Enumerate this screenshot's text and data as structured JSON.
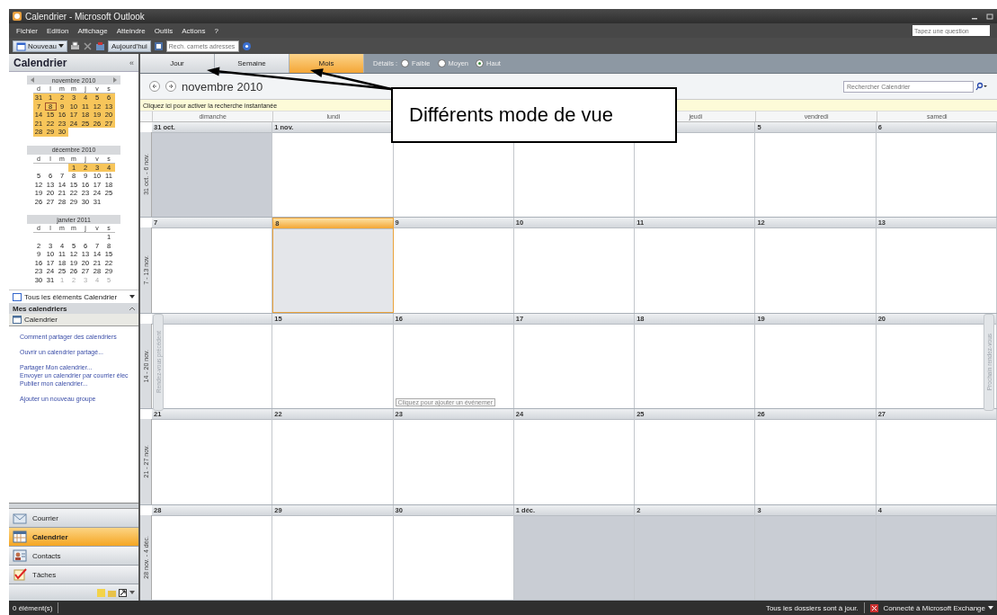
{
  "window": {
    "title": "Calendrier - Microsoft Outlook"
  },
  "menu": [
    "Fichier",
    "Edition",
    "Affichage",
    "Atteindre",
    "Outils",
    "Actions",
    "?"
  ],
  "help_box": {
    "placeholder": "Tapez une question"
  },
  "toolbar": {
    "new_label": "Nouveau",
    "today_label": "Aujourd'hui",
    "address_search": {
      "placeholder": "Rech. carnets adresses"
    }
  },
  "sidebar": {
    "title": "Calendrier",
    "collapse": "«",
    "mini_months": [
      {
        "title": "novembre 2010",
        "nav": true,
        "weekdays": [
          "d",
          "l",
          "m",
          "m",
          "j",
          "v",
          "s"
        ],
        "weeks": [
          {
            "days": [
              {
                "d": "31",
                "hl": true,
                "today": false,
                "dim": false
              },
              {
                "d": "1",
                "hl": true,
                "today": false,
                "dim": false
              },
              {
                "d": "2",
                "hl": true,
                "today": false,
                "dim": false
              },
              {
                "d": "3",
                "hl": true,
                "today": false,
                "dim": false
              },
              {
                "d": "4",
                "hl": true,
                "today": false,
                "dim": false
              },
              {
                "d": "5",
                "hl": true,
                "today": false,
                "dim": false
              },
              {
                "d": "6",
                "hl": true,
                "today": false,
                "dim": false
              }
            ]
          },
          {
            "days": [
              {
                "d": "7",
                "hl": true,
                "today": false,
                "dim": false
              },
              {
                "d": "8",
                "hl": true,
                "today": true,
                "dim": false
              },
              {
                "d": "9",
                "hl": true,
                "today": false,
                "dim": false
              },
              {
                "d": "10",
                "hl": true,
                "today": false,
                "dim": false
              },
              {
                "d": "11",
                "hl": true,
                "today": false,
                "dim": false
              },
              {
                "d": "12",
                "hl": true,
                "today": false,
                "dim": false
              },
              {
                "d": "13",
                "hl": true,
                "today": false,
                "dim": false
              }
            ]
          },
          {
            "days": [
              {
                "d": "14",
                "hl": true,
                "today": false,
                "dim": false
              },
              {
                "d": "15",
                "hl": true,
                "today": false,
                "dim": false
              },
              {
                "d": "16",
                "hl": true,
                "today": false,
                "dim": false
              },
              {
                "d": "17",
                "hl": true,
                "today": false,
                "dim": false
              },
              {
                "d": "18",
                "hl": true,
                "today": false,
                "dim": false
              },
              {
                "d": "19",
                "hl": true,
                "today": false,
                "dim": false
              },
              {
                "d": "20",
                "hl": true,
                "today": false,
                "dim": false
              }
            ]
          },
          {
            "days": [
              {
                "d": "21",
                "hl": true,
                "today": false,
                "dim": false
              },
              {
                "d": "22",
                "hl": true,
                "today": false,
                "dim": false
              },
              {
                "d": "23",
                "hl": true,
                "today": false,
                "dim": false
              },
              {
                "d": "24",
                "hl": true,
                "today": false,
                "dim": false
              },
              {
                "d": "25",
                "hl": true,
                "today": false,
                "dim": false
              },
              {
                "d": "26",
                "hl": true,
                "today": false,
                "dim": false
              },
              {
                "d": "27",
                "hl": true,
                "today": false,
                "dim": false
              }
            ]
          },
          {
            "days": [
              {
                "d": "28",
                "hl": true,
                "today": false,
                "dim": false
              },
              {
                "d": "29",
                "hl": true,
                "today": false,
                "dim": false
              },
              {
                "d": "30",
                "hl": true,
                "today": false,
                "dim": false
              }
            ]
          }
        ]
      },
      {
        "title": "décembre 2010",
        "nav": false,
        "weekdays": [
          "d",
          "l",
          "m",
          "m",
          "j",
          "v",
          "s"
        ],
        "weeks": [
          {
            "days": [
              {
                "d": "1",
                "hl": true,
                "today": false,
                "dim": false
              },
              {
                "d": "2",
                "hl": true,
                "today": false,
                "dim": false
              },
              {
                "d": "3",
                "hl": true,
                "today": false,
                "dim": false
              },
              {
                "d": "4",
                "hl": true,
                "today": false,
                "dim": false
              }
            ]
          },
          {
            "days": [
              {
                "d": "5",
                "hl": false,
                "today": false,
                "dim": false
              },
              {
                "d": "6",
                "hl": false,
                "today": false,
                "dim": false
              },
              {
                "d": "7",
                "hl": false,
                "today": false,
                "dim": false
              },
              {
                "d": "8",
                "hl": false,
                "today": false,
                "dim": false
              },
              {
                "d": "9",
                "hl": false,
                "today": false,
                "dim": false
              },
              {
                "d": "10",
                "hl": false,
                "today": false,
                "dim": false
              },
              {
                "d": "11",
                "hl": false,
                "today": false,
                "dim": false
              }
            ]
          },
          {
            "days": [
              {
                "d": "12",
                "hl": false,
                "today": false,
                "dim": false
              },
              {
                "d": "13",
                "hl": false,
                "today": false,
                "dim": false
              },
              {
                "d": "14",
                "hl": false,
                "today": false,
                "dim": false
              },
              {
                "d": "15",
                "hl": false,
                "today": false,
                "dim": false
              },
              {
                "d": "16",
                "hl": false,
                "today": false,
                "dim": false
              },
              {
                "d": "17",
                "hl": false,
                "today": false,
                "dim": false
              },
              {
                "d": "18",
                "hl": false,
                "today": false,
                "dim": false
              }
            ]
          },
          {
            "days": [
              {
                "d": "19",
                "hl": false,
                "today": false,
                "dim": false
              },
              {
                "d": "20",
                "hl": false,
                "today": false,
                "dim": false
              },
              {
                "d": "21",
                "hl": false,
                "today": false,
                "dim": false
              },
              {
                "d": "22",
                "hl": false,
                "today": false,
                "dim": false
              },
              {
                "d": "23",
                "hl": false,
                "today": false,
                "dim": false
              },
              {
                "d": "24",
                "hl": false,
                "today": false,
                "dim": false
              },
              {
                "d": "25",
                "hl": false,
                "today": false,
                "dim": false
              }
            ]
          },
          {
            "days": [
              {
                "d": "26",
                "hl": false,
                "today": false,
                "dim": false
              },
              {
                "d": "27",
                "hl": false,
                "today": false,
                "dim": false
              },
              {
                "d": "28",
                "hl": false,
                "today": false,
                "dim": false
              },
              {
                "d": "29",
                "hl": false,
                "today": false,
                "dim": false
              },
              {
                "d": "30",
                "hl": false,
                "today": false,
                "dim": false
              },
              {
                "d": "31",
                "hl": false,
                "today": false,
                "dim": false
              }
            ]
          }
        ]
      },
      {
        "title": "janvier 2011",
        "nav": false,
        "weekdays": [
          "d",
          "l",
          "m",
          "m",
          "j",
          "v",
          "s"
        ],
        "weeks": [
          {
            "days": [
              {
                "d": "1",
                "hl": false,
                "today": false,
                "dim": false
              }
            ]
          },
          {
            "days": [
              {
                "d": "2",
                "hl": false,
                "today": false,
                "dim": false
              },
              {
                "d": "3",
                "hl": false,
                "today": false,
                "dim": false
              },
              {
                "d": "4",
                "hl": false,
                "today": false,
                "dim": false
              },
              {
                "d": "5",
                "hl": false,
                "today": false,
                "dim": false
              },
              {
                "d": "6",
                "hl": false,
                "today": false,
                "dim": false
              },
              {
                "d": "7",
                "hl": false,
                "today": false,
                "dim": false
              },
              {
                "d": "8",
                "hl": false,
                "today": false,
                "dim": false
              }
            ]
          },
          {
            "days": [
              {
                "d": "9",
                "hl": false,
                "today": false,
                "dim": false
              },
              {
                "d": "10",
                "hl": false,
                "today": false,
                "dim": false
              },
              {
                "d": "11",
                "hl": false,
                "today": false,
                "dim": false
              },
              {
                "d": "12",
                "hl": false,
                "today": false,
                "dim": false
              },
              {
                "d": "13",
                "hl": false,
                "today": false,
                "dim": false
              },
              {
                "d": "14",
                "hl": false,
                "today": false,
                "dim": false
              },
              {
                "d": "15",
                "hl": false,
                "today": false,
                "dim": false
              }
            ]
          },
          {
            "days": [
              {
                "d": "16",
                "hl": false,
                "today": false,
                "dim": false
              },
              {
                "d": "17",
                "hl": false,
                "today": false,
                "dim": false
              },
              {
                "d": "18",
                "hl": false,
                "today": false,
                "dim": false
              },
              {
                "d": "19",
                "hl": false,
                "today": false,
                "dim": false
              },
              {
                "d": "20",
                "hl": false,
                "today": false,
                "dim": false
              },
              {
                "d": "21",
                "hl": false,
                "today": false,
                "dim": false
              },
              {
                "d": "22",
                "hl": false,
                "today": false,
                "dim": false
              }
            ]
          },
          {
            "days": [
              {
                "d": "23",
                "hl": false,
                "today": false,
                "dim": false
              },
              {
                "d": "24",
                "hl": false,
                "today": false,
                "dim": false
              },
              {
                "d": "25",
                "hl": false,
                "today": false,
                "dim": false
              },
              {
                "d": "26",
                "hl": false,
                "today": false,
                "dim": false
              },
              {
                "d": "27",
                "hl": false,
                "today": false,
                "dim": false
              },
              {
                "d": "28",
                "hl": false,
                "today": false,
                "dim": false
              },
              {
                "d": "29",
                "hl": false,
                "today": false,
                "dim": false
              }
            ]
          },
          {
            "days": [
              {
                "d": "30",
                "hl": false,
                "today": false,
                "dim": false
              },
              {
                "d": "31",
                "hl": false,
                "today": false,
                "dim": false
              },
              {
                "d": "1",
                "hl": false,
                "today": false,
                "dim": true
              },
              {
                "d": "2",
                "hl": false,
                "today": false,
                "dim": true
              },
              {
                "d": "3",
                "hl": false,
                "today": false,
                "dim": true
              },
              {
                "d": "4",
                "hl": false,
                "today": false,
                "dim": true
              },
              {
                "d": "5",
                "hl": false,
                "today": false,
                "dim": true
              }
            ]
          }
        ]
      }
    ],
    "all_items": "Tous les éléments Calendrier",
    "my_calendars": {
      "title": "Mes calendriers",
      "items": [
        "Calendrier"
      ]
    },
    "link_groups": [
      [
        "Comment partager des calendriers"
      ],
      [
        "Ouvrir un calendrier partagé..."
      ],
      [
        "Partager Mon calendrier...",
        "Envoyer un calendrier par courrier élec",
        "Publier mon calendrier..."
      ],
      [
        "Ajouter un nouveau groupe"
      ]
    ],
    "nav": [
      {
        "label": "Courrier",
        "kind": "mail",
        "selected": false
      },
      {
        "label": "Calendrier",
        "kind": "calendar",
        "selected": true
      },
      {
        "label": "Contacts",
        "kind": "contacts",
        "selected": false
      },
      {
        "label": "Tâches",
        "kind": "tasks",
        "selected": false
      }
    ]
  },
  "view_tabs": [
    {
      "label": "Jour",
      "selected": false
    },
    {
      "label": "Semaine",
      "selected": false
    },
    {
      "label": "Mois",
      "selected": true
    }
  ],
  "details": {
    "label": "Détails :",
    "options": [
      {
        "label": "Faible",
        "selected": false
      },
      {
        "label": "Moyen",
        "selected": false
      },
      {
        "label": "Haut",
        "selected": true
      }
    ]
  },
  "month_title": "novembre 2010",
  "search": {
    "placeholder": "Rechercher Calendrier"
  },
  "instant_search_bar": "Cliquez ici pour activer la recherche instantanée",
  "weekdays_left": [
    "dimanche",
    "lundi"
  ],
  "weekdays_right": [
    "jeudi",
    "vendredi",
    "samedi"
  ],
  "weeks": [
    {
      "label": "31 oct. - 6 nov.",
      "days": [
        {
          "date": "31 oct.",
          "other": true,
          "today": false,
          "selected": false
        },
        {
          "date": "1 nov.",
          "other": false,
          "today": false,
          "selected": false
        },
        {
          "other": false,
          "selected": false
        },
        {
          "other": false,
          "selected": false
        },
        {
          "other": false,
          "selected": false
        },
        {
          "date": "5",
          "other": false,
          "today": false,
          "selected": false
        },
        {
          "date": "6",
          "other": false,
          "today": false,
          "selected": false
        }
      ]
    },
    {
      "label": "7 - 13 nov.",
      "days": [
        {
          "date": "7",
          "other": false,
          "today": false,
          "selected": false
        },
        {
          "date": "8",
          "other": false,
          "today": true,
          "selected": true
        },
        {
          "date": "9",
          "other": false,
          "today": false,
          "selected": false
        },
        {
          "date": "10",
          "other": false,
          "today": false,
          "selected": false
        },
        {
          "date": "11",
          "other": false,
          "today": false,
          "selected": false
        },
        {
          "date": "12",
          "other": false,
          "today": false,
          "selected": false
        },
        {
          "date": "13",
          "other": false,
          "today": false,
          "selected": false
        }
      ]
    },
    {
      "label": "14 - 20 nov.",
      "days": [
        {
          "other": false,
          "selected": false
        },
        {
          "date": "15",
          "other": false,
          "today": false,
          "selected": false
        },
        {
          "date": "16",
          "other": false,
          "today": false,
          "selected": false,
          "hint": "Cliquez pour ajouter un événemer"
        },
        {
          "date": "17",
          "other": false,
          "today": false,
          "selected": false
        },
        {
          "date": "18",
          "other": false,
          "today": false,
          "selected": false
        },
        {
          "date": "19",
          "other": false,
          "today": false,
          "selected": false
        },
        {
          "date": "20",
          "other": false,
          "today": false,
          "selected": false
        }
      ]
    },
    {
      "label": "21 - 27 nov.",
      "days": [
        {
          "date": "21",
          "other": false,
          "today": false,
          "selected": false
        },
        {
          "date": "22",
          "other": false,
          "today": false,
          "selected": false
        },
        {
          "date": "23",
          "other": false,
          "today": false,
          "selected": false
        },
        {
          "date": "24",
          "other": false,
          "today": false,
          "selected": false
        },
        {
          "date": "25",
          "other": false,
          "today": false,
          "selected": false
        },
        {
          "date": "26",
          "other": false,
          "today": false,
          "selected": false
        },
        {
          "date": "27",
          "other": false,
          "today": false,
          "selected": false
        }
      ]
    },
    {
      "label": "28 nov. - 4 déc.",
      "days": [
        {
          "date": "28",
          "other": false,
          "today": false,
          "selected": false
        },
        {
          "date": "29",
          "other": false,
          "today": false,
          "selected": false
        },
        {
          "date": "30",
          "other": false,
          "today": false,
          "selected": false
        },
        {
          "date": "1 déc.",
          "other": true,
          "today": false,
          "selected": false
        },
        {
          "date": "2",
          "other": true,
          "today": false,
          "selected": false
        },
        {
          "date": "3",
          "other": true,
          "today": false,
          "selected": false
        },
        {
          "date": "4",
          "other": true,
          "today": false,
          "selected": false
        }
      ]
    }
  ],
  "side_tabs": {
    "previous": "Rendez-vous précédent",
    "next": "Prochain rendez-vous"
  },
  "annotation": "Différents mode de vue",
  "status_bar": {
    "items": "0 élément(s)",
    "sync": "Tous les dossiers sont à jour.",
    "connection": "Connecté à Microsoft Exchange"
  }
}
